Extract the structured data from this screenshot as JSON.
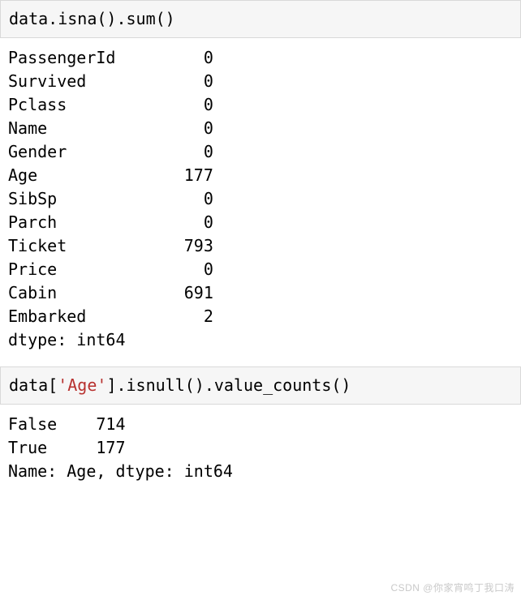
{
  "cell1": {
    "code_plain": "data.isna().sum()",
    "out_rows": [
      [
        "PassengerId",
        "0"
      ],
      [
        "Survived",
        "0"
      ],
      [
        "Pclass",
        "0"
      ],
      [
        "Name",
        "0"
      ],
      [
        "Gender",
        "0"
      ],
      [
        "Age",
        "177"
      ],
      [
        "SibSp",
        "0"
      ],
      [
        "Parch",
        "0"
      ],
      [
        "Ticket",
        "793"
      ],
      [
        "Price",
        "0"
      ],
      [
        "Cabin",
        "691"
      ],
      [
        "Embarked",
        "2"
      ]
    ],
    "tail": "dtype: int64"
  },
  "cell2": {
    "code_pre": "data[",
    "code_str": "'Age'",
    "code_post": "].isnull().value_counts()",
    "out_rows": [
      [
        "False",
        "714"
      ],
      [
        "True",
        "177"
      ]
    ],
    "tail": "Name: Age, dtype: int64"
  },
  "watermark": "CSDN @你家宵鸣丁我口涛"
}
